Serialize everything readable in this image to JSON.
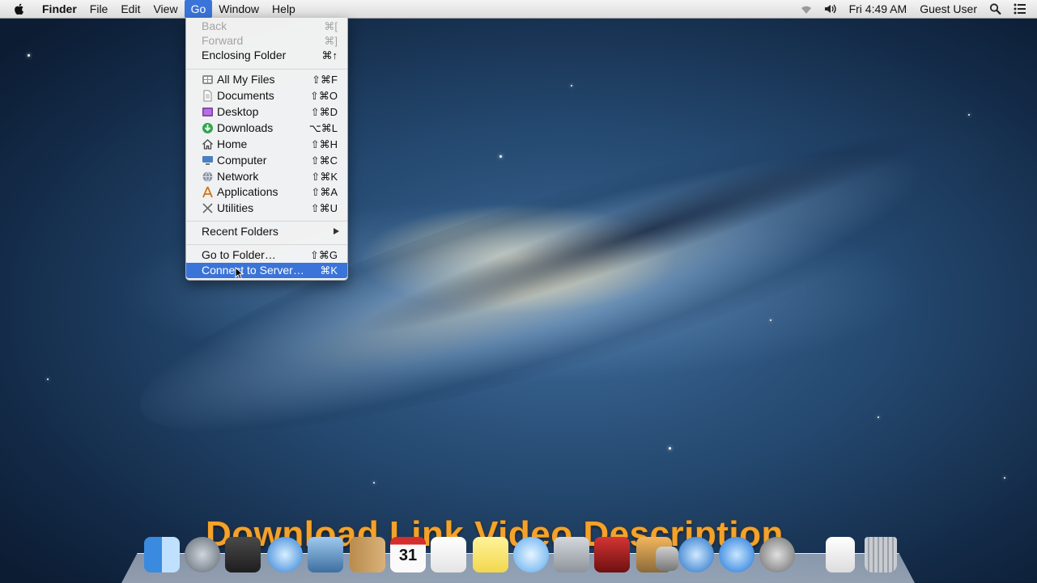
{
  "menubar": {
    "apple": "apple-icon",
    "items": [
      {
        "label": "Finder",
        "bold": true
      },
      {
        "label": "File"
      },
      {
        "label": "Edit"
      },
      {
        "label": "View"
      },
      {
        "label": "Go",
        "active": true
      },
      {
        "label": "Window"
      },
      {
        "label": "Help"
      }
    ],
    "right": {
      "time": "Fri 4:49 AM",
      "user": "Guest User",
      "icons": [
        "wifi-icon",
        "volume-icon",
        "spotlight-search-icon",
        "notification-center-icon"
      ]
    }
  },
  "go_menu": {
    "back": {
      "label": "Back",
      "shortcut": "⌘["
    },
    "forward": {
      "label": "Forward",
      "shortcut": "⌘]"
    },
    "enclosing": {
      "label": "Enclosing Folder",
      "shortcut": "⌘↑"
    },
    "places": [
      {
        "label": "All My Files",
        "shortcut": "⇧⌘F",
        "icon": "all-my-files-icon"
      },
      {
        "label": "Documents",
        "shortcut": "⇧⌘O",
        "icon": "documents-icon"
      },
      {
        "label": "Desktop",
        "shortcut": "⇧⌘D",
        "icon": "desktop-icon"
      },
      {
        "label": "Downloads",
        "shortcut": "⌥⌘L",
        "icon": "downloads-icon"
      },
      {
        "label": "Home",
        "shortcut": "⇧⌘H",
        "icon": "home-icon"
      },
      {
        "label": "Computer",
        "shortcut": "⇧⌘C",
        "icon": "computer-icon"
      },
      {
        "label": "Network",
        "shortcut": "⇧⌘K",
        "icon": "network-icon"
      },
      {
        "label": "Applications",
        "shortcut": "⇧⌘A",
        "icon": "applications-icon"
      },
      {
        "label": "Utilities",
        "shortcut": "⇧⌘U",
        "icon": "utilities-icon"
      }
    ],
    "recent": {
      "label": "Recent Folders"
    },
    "goto": {
      "label": "Go to Folder…",
      "shortcut": "⇧⌘G"
    },
    "connect": {
      "label": "Connect to Server…",
      "shortcut": "⌘K"
    }
  },
  "overlay_text": "Download Link Video Description",
  "dock": {
    "apps": [
      "finder-icon",
      "launchpad-icon",
      "mission-control-icon",
      "safari-icon",
      "preview-icon",
      "contacts-icon",
      "calendar-icon",
      "reminders-icon",
      "notes-icon",
      "messages-icon",
      "facetime-icon",
      "photo-booth-icon",
      "iphoto-icon",
      "image-capture-icon",
      "itunes-icon",
      "app-store-icon",
      "system-preferences-icon",
      "document-icon",
      "trash-icon"
    ],
    "calendar_day": "31"
  },
  "colors": {
    "highlight": "#3b74d8",
    "overlay": "#f3a22b"
  }
}
